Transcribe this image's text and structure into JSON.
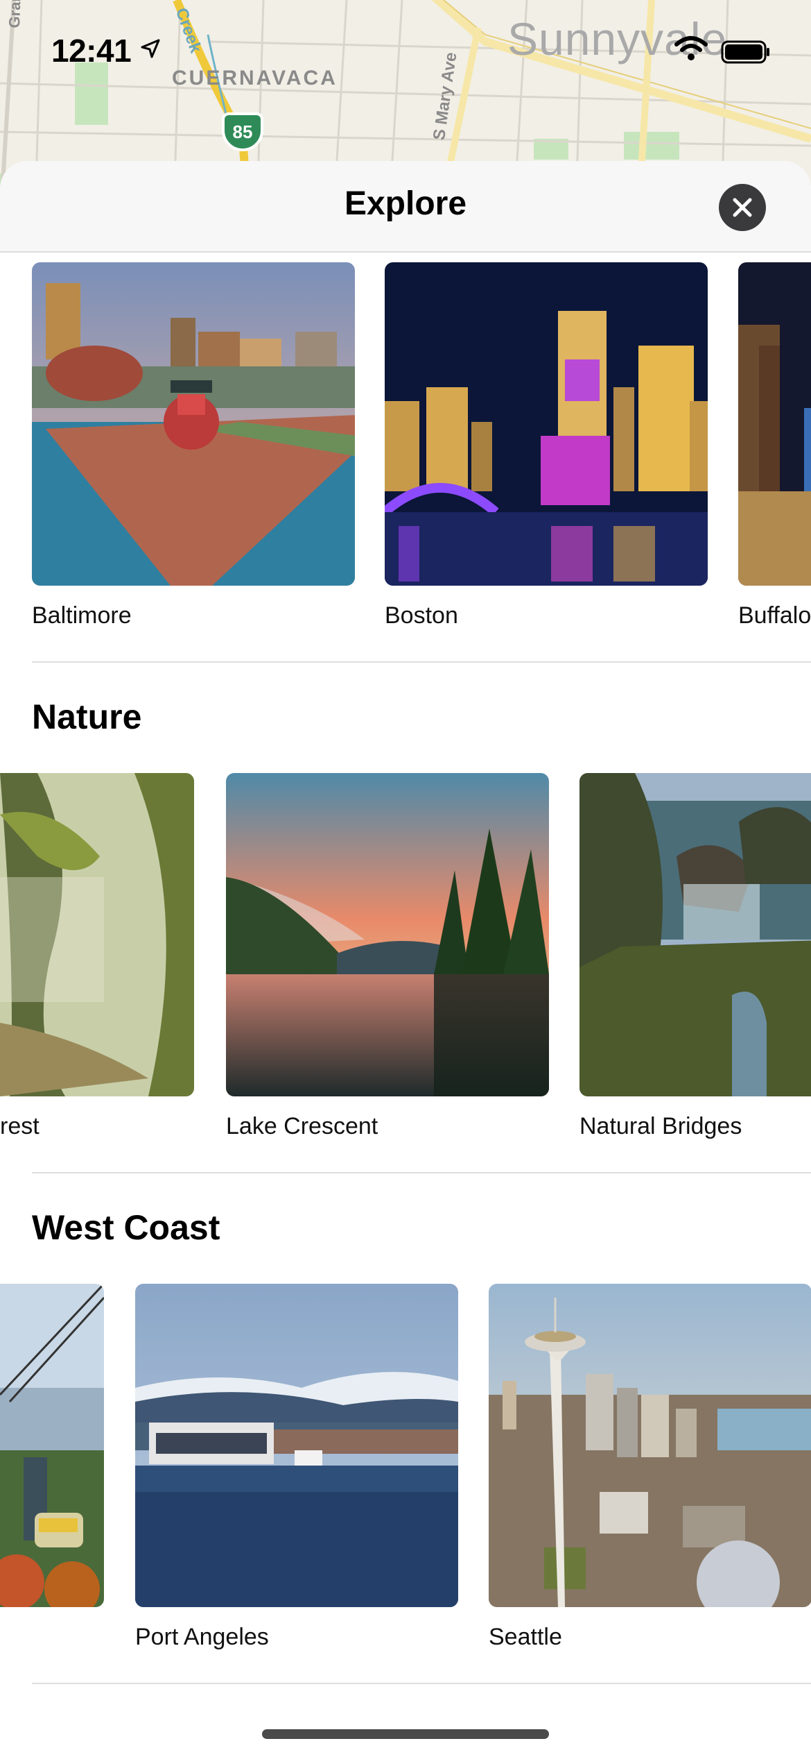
{
  "status_bar": {
    "time": "12:41",
    "map_city": "Sunnyvale"
  },
  "map_labels": {
    "street_a": "Grant Rd",
    "street_b": "Creek",
    "area": "CUERNAVACA",
    "route": "85",
    "avenue": "S Mary Ave"
  },
  "header": {
    "title": "Explore"
  },
  "sections": [
    {
      "title": "",
      "items": [
        {
          "label": "Baltimore"
        },
        {
          "label": "Boston"
        },
        {
          "label": "Buffalo"
        }
      ]
    },
    {
      "title": "Nature",
      "items": [
        {
          "label": "rest"
        },
        {
          "label": "Lake Crescent"
        },
        {
          "label": "Natural Bridges"
        }
      ]
    },
    {
      "title": "West Coast",
      "items": [
        {
          "label": ""
        },
        {
          "label": "Port Angeles"
        },
        {
          "label": "Seattle"
        }
      ]
    }
  ]
}
